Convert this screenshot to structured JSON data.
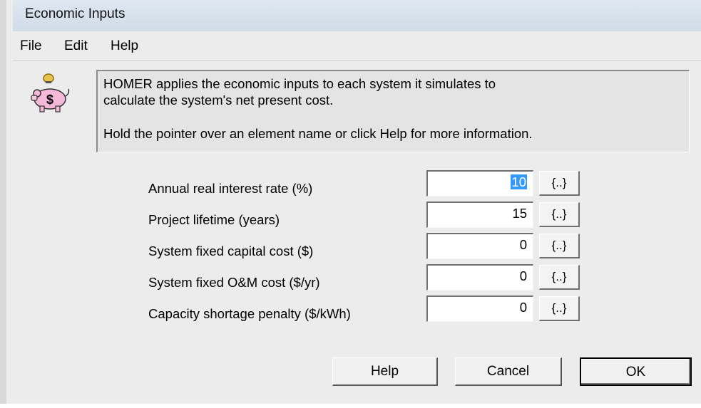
{
  "window": {
    "title": "Economic Inputs"
  },
  "menu": {
    "items": [
      "File",
      "Edit",
      "Help"
    ]
  },
  "info": {
    "line1": "HOMER applies the economic inputs to each system it simulates to",
    "line2": "calculate the system's net present cost.",
    "line3": "Hold the pointer over an element name or click Help for more information."
  },
  "fields": [
    {
      "label": "Annual real interest rate (%)",
      "value": "10",
      "sensitivity": "{..}"
    },
    {
      "label": "Project lifetime (years)",
      "value": "15",
      "sensitivity": "{..}"
    },
    {
      "label": "System fixed capital cost ($)",
      "value": "0",
      "sensitivity": "{..}"
    },
    {
      "label": "System fixed O&M cost ($/yr)",
      "value": "0",
      "sensitivity": "{..}"
    },
    {
      "label": "Capacity shortage penalty ($/kWh)",
      "value": "0",
      "sensitivity": "{..}"
    }
  ],
  "buttons": {
    "help": "Help",
    "cancel": "Cancel",
    "ok": "OK"
  },
  "icons": {
    "info": "piggy-bank-icon"
  },
  "colors": {
    "selection": "#3399ff",
    "titlebar": "#d6e1ec"
  }
}
